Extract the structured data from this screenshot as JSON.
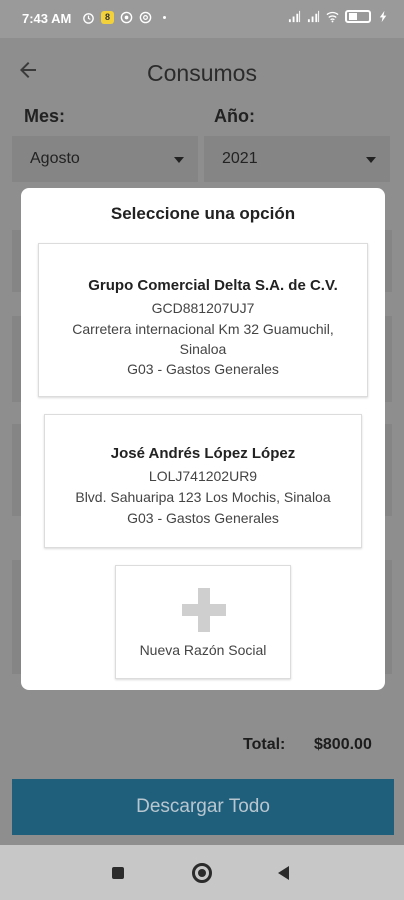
{
  "status_bar": {
    "time": "7:43 AM",
    "notification_badge": "8",
    "battery_level": "4"
  },
  "header": {
    "title": "Consumos",
    "back_icon": "arrow-left-icon"
  },
  "filters": {
    "month_label": "Mes:",
    "month_value": "Agosto",
    "year_label": "Año:",
    "year_value": "2021"
  },
  "summary": {
    "total_label": "Total:",
    "total_value": "$800.00"
  },
  "download_button": {
    "label": "Descargar Todo"
  },
  "dialog": {
    "title": "Seleccione una opción",
    "options": [
      {
        "name": "Grupo Comercial Delta S.A. de C.V.",
        "rfc": "GCD881207UJ7",
        "address": "Carretera internacional Km 32 Guamuchil, Sinaloa",
        "regime": "G03 - Gastos Generales"
      },
      {
        "name": "José Andrés López López",
        "rfc": "LOLJ741202UR9",
        "address": "Blvd. Sahuaripa 123 Los Mochis, Sinaloa",
        "regime": "G03 - Gastos Generales"
      }
    ],
    "new_option_label": "Nueva Razón Social"
  },
  "colors": {
    "primary": "#1f5f7c",
    "overlay": "#8e8e8e"
  }
}
